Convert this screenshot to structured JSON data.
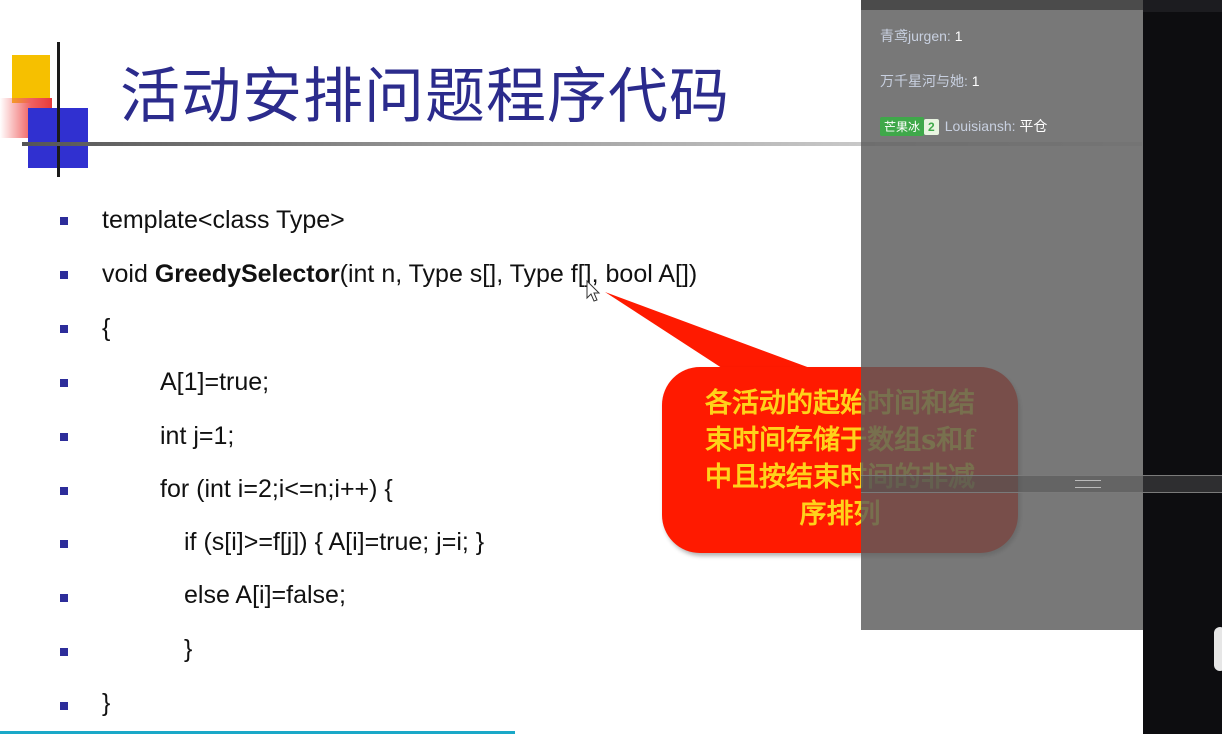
{
  "slide": {
    "title": "活动安排问题程序代码",
    "code_lines": [
      {
        "text": "template<class Type>"
      },
      {
        "pre": "void ",
        "bold": "GreedySelector",
        "post": "(int n, Type s[], Type f[], bool A[])"
      },
      {
        "text": "{"
      },
      {
        "text": "A[1]=true;"
      },
      {
        "text": "int j=1;"
      },
      {
        "text": "for (int i=2;i<=n;i++) {"
      },
      {
        "text": "if (s[i]>=f[j]) { A[i]=true; j=i; }"
      },
      {
        "text": "else A[i]=false;"
      },
      {
        "text": "}"
      },
      {
        "text": "}"
      }
    ],
    "callout_lines": [
      "各活动的起始时间和结",
      "束时间存储于数组s和f",
      "中且按结束时间的非减",
      "序排列"
    ]
  },
  "chat": {
    "messages": [
      {
        "user": "青鸢jurgen:",
        "text": "1"
      },
      {
        "user": "万千星河与她:",
        "text": "1"
      },
      {
        "badge": "芒果冰",
        "badge_level": "2",
        "user": "Louisiansh:",
        "text": "平仓"
      }
    ]
  },
  "colors": {
    "title": "#2b2b8c",
    "bullet": "#2d2d9a",
    "callout_bg": "#ff1a00",
    "callout_text": "#ffd21a",
    "badge": "#3fa84a"
  },
  "icons": [
    "mouse-cursor-icon",
    "splitter-grip-icon"
  ]
}
